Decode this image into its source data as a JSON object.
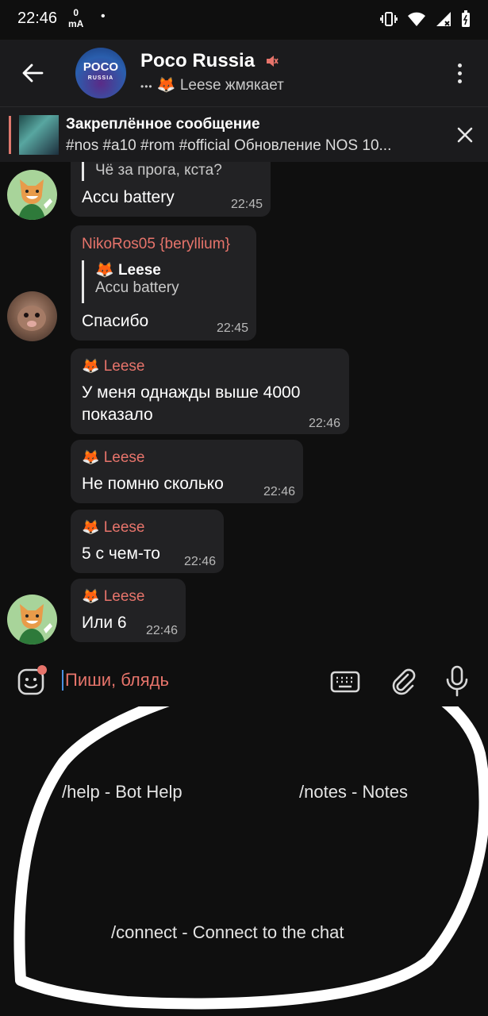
{
  "status_bar": {
    "time": "22:46",
    "current_value": "0",
    "current_unit": "mA",
    "dot": "•"
  },
  "header": {
    "title": "Poco Russia",
    "typing_dots": "•••",
    "typing_text": "Leese жмякает",
    "avatar_logo": "POCO",
    "avatar_logo_sub": "RUSSIA"
  },
  "pinned": {
    "title": "Закреплённое сообщение",
    "text": "#nos #a10 #rom #official  Обновление NOS 10..."
  },
  "messages": [
    {
      "reply_text": "Чё за прога, кста?",
      "text": "Accu battery",
      "time": "22:45"
    },
    {
      "sender": "NikoRos05 {beryllium}",
      "reply_name": "Leese",
      "reply_text": "Accu battery",
      "text": "Спасибо",
      "time": "22:45"
    },
    {
      "sender": "Leese",
      "text_line1": "У меня однажды выше 4000",
      "text_line2": "показало",
      "time": "22:46"
    },
    {
      "sender": "Leese",
      "text": "Не помню сколько",
      "time": "22:46"
    },
    {
      "sender": "Leese",
      "text": "5 с чем-то",
      "time": "22:46"
    },
    {
      "sender": "Leese",
      "text": "Или 6",
      "time": "22:46"
    }
  ],
  "input": {
    "placeholder": "Пиши, блядь"
  },
  "commands": [
    "/help - Bot Help",
    "/notes - Notes",
    "/connect - Connect to the chat"
  ],
  "colors": {
    "accent_red": "#e7746b",
    "bubble": "#222224",
    "header_bg": "#1b1b1d",
    "background": "#0f0f0f"
  }
}
